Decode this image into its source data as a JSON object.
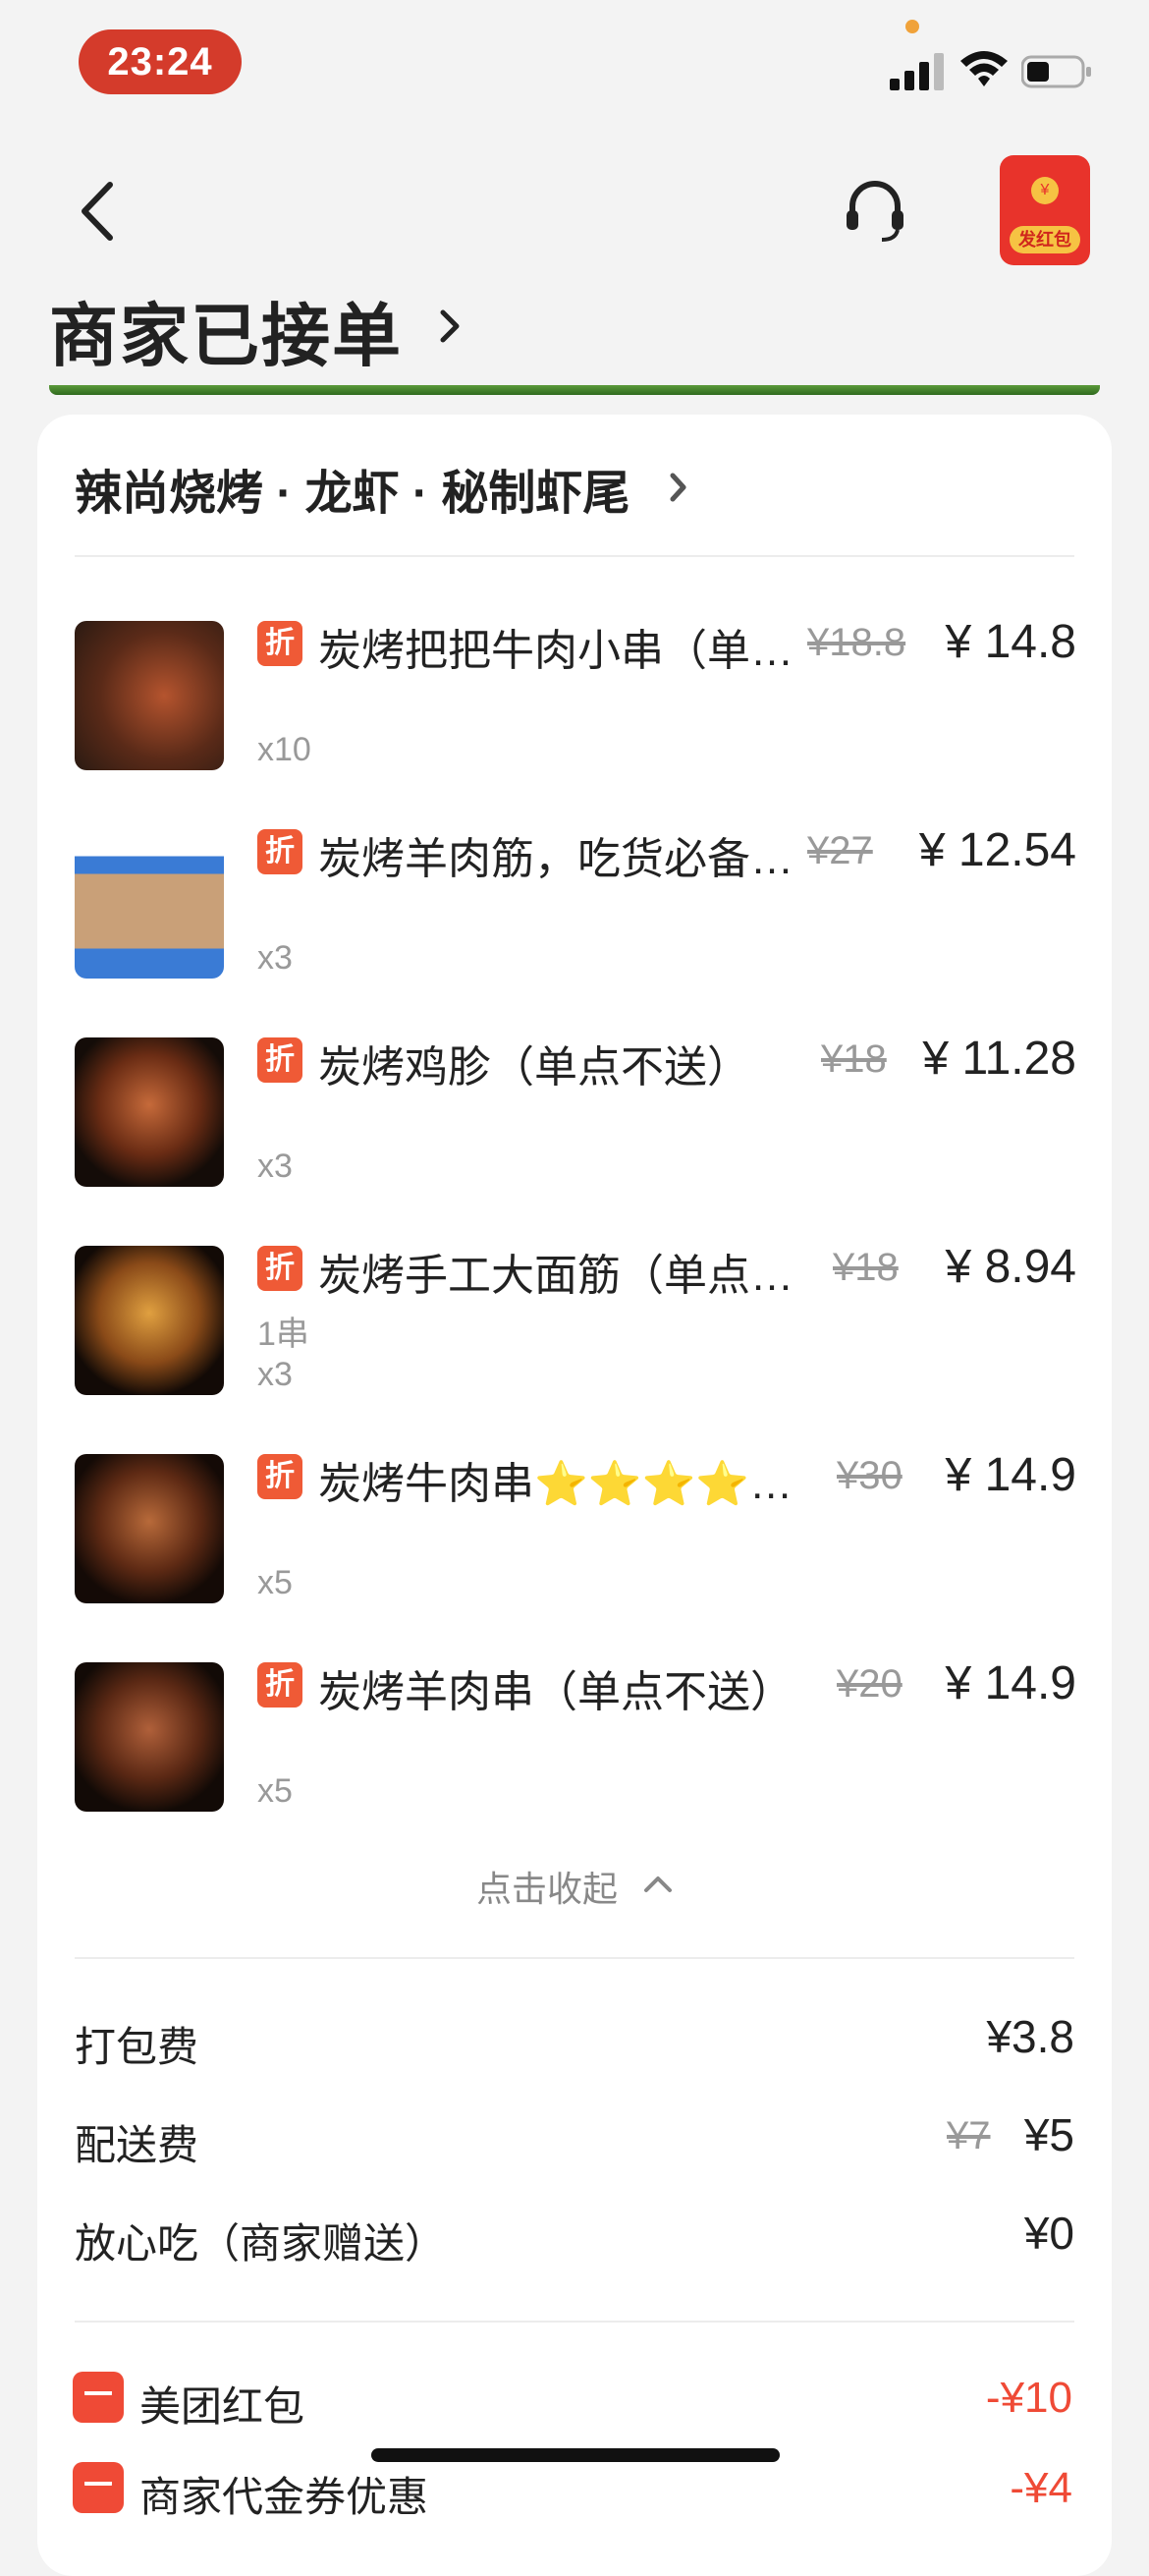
{
  "status": {
    "time": "23:24"
  },
  "nav": {
    "redpacket_label": "发红包",
    "coin_symbol": "¥"
  },
  "header": {
    "title": "商家已接单"
  },
  "shop": {
    "name": "辣尚烧烤 · 龙虾 · 秘制虾尾"
  },
  "items": [
    {
      "badge": "折",
      "name": "炭烤把把牛肉小串（单…",
      "old_price": "¥18.8",
      "price": "¥ 14.8",
      "spec": "",
      "qty": "x10"
    },
    {
      "badge": "折",
      "name": "炭烤羊肉筋，吃货必备…",
      "old_price": "¥27",
      "price": "¥ 12.54",
      "spec": "",
      "qty": "x3"
    },
    {
      "badge": "折",
      "name": "炭烤鸡胗（单点不送）",
      "old_price": "¥18",
      "price": "¥ 11.28",
      "spec": "",
      "qty": "x3"
    },
    {
      "badge": "折",
      "name": "炭烤手工大面筋（单点…",
      "old_price": "¥18",
      "price": "¥ 8.94",
      "spec": "1串",
      "qty": "x3"
    },
    {
      "badge": "折",
      "name": "炭烤牛肉串⭐⭐⭐⭐…",
      "old_price": "¥30",
      "price": "¥ 14.9",
      "spec": "",
      "qty": "x5"
    },
    {
      "badge": "折",
      "name": "炭烤羊肉串（单点不送）",
      "old_price": "¥20",
      "price": "¥ 14.9",
      "spec": "",
      "qty": "x5"
    }
  ],
  "collapse_label": "点击收起",
  "fees": {
    "packing": {
      "label": "打包费",
      "value": "¥3.8"
    },
    "delivery": {
      "label": "配送费",
      "old_value": "¥7",
      "value": "¥5"
    },
    "safe": {
      "label": "放心吃（商家赠送）",
      "value": "¥0"
    }
  },
  "discounts": {
    "hongbao": {
      "label": "美团红包",
      "value": "-¥10"
    },
    "voucher": {
      "label": "商家代金券优惠",
      "value": "-¥4"
    }
  },
  "colors": {
    "accent_red": "#ef4a36",
    "time_pill": "#d43b2b"
  }
}
